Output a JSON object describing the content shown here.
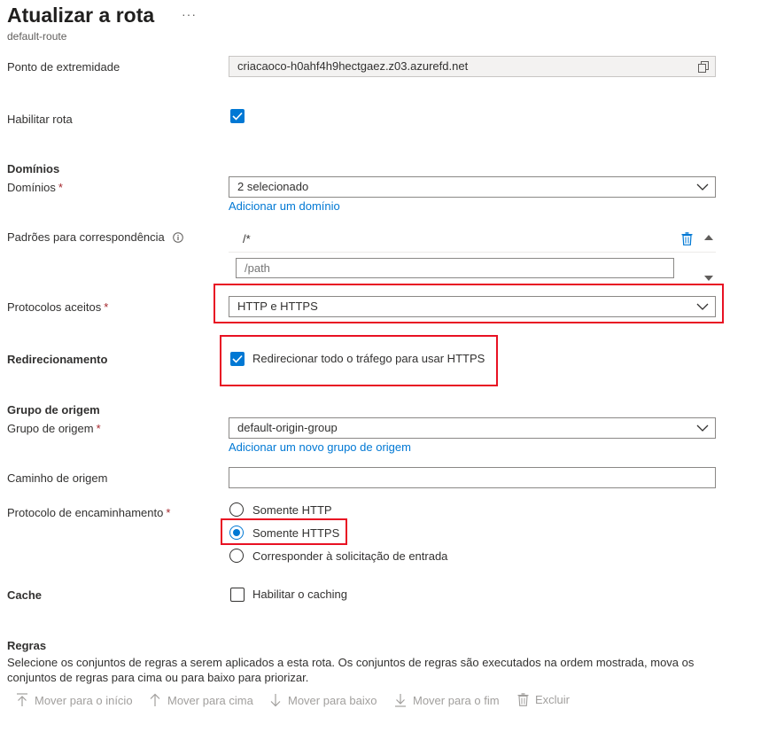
{
  "header": {
    "title": "Atualizar a rota",
    "more": "···",
    "subtitle": "default-route"
  },
  "endpoint": {
    "label": "Ponto de extremidade",
    "value": "criacaoco-h0ahf4h9hectgaez.z03.azurefd.net",
    "copy_icon": "copy-icon"
  },
  "enable_route": {
    "label": "Habilitar rota",
    "checked": true
  },
  "domains": {
    "section": "Domínios",
    "label": "Domínios",
    "required": "*",
    "value": "2 selecionado",
    "add_link": "Adicionar um domínio"
  },
  "patterns": {
    "label": "Padrões para correspondência",
    "info_icon": "info-icon",
    "items": [
      "/*"
    ],
    "placeholder": "/path",
    "delete_icon": "trash-icon"
  },
  "protocols": {
    "label": "Protocolos aceitos",
    "required": "*",
    "value": "HTTP e HTTPS"
  },
  "redirect": {
    "label": "Redirecionamento",
    "option": "Redirecionar todo o tráfego para usar HTTPS",
    "checked": true
  },
  "origin_group": {
    "section": "Grupo de origem",
    "label": "Grupo de origem",
    "required": "*",
    "value": "default-origin-group",
    "add_link": "Adicionar um novo grupo de origem"
  },
  "origin_path": {
    "label": "Caminho de origem",
    "value": ""
  },
  "forwarding": {
    "label": "Protocolo de encaminhamento",
    "required": "*",
    "options": [
      "Somente HTTP",
      "Somente HTTPS",
      "Corresponder à solicitação de entrada"
    ],
    "selected": "Somente HTTPS"
  },
  "cache": {
    "label": "Cache",
    "option": "Habilitar o caching",
    "checked": false
  },
  "rules": {
    "section": "Regras",
    "description": "Selecione os conjuntos de regras a serem aplicados a esta rota. Os conjuntos de regras são executados na ordem mostrada, mova os conjuntos de regras para cima ou para baixo para priorizar.",
    "toolbar": {
      "move_top": "Mover para o início",
      "move_up": "Mover para cima",
      "move_down": "Mover para baixo",
      "move_bottom": "Mover para o fim",
      "delete": "Excluir"
    }
  },
  "colors": {
    "accent": "#0078d4",
    "highlight": "#e81123",
    "required": "#a4262c"
  }
}
